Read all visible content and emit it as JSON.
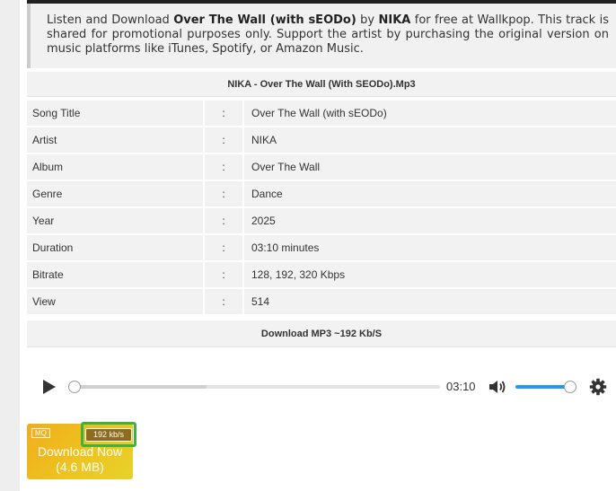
{
  "intro": {
    "t1": "Listen and Download ",
    "track": "Over The Wall (with sEODo)",
    "t2": " by ",
    "artist": "NIKA",
    "t3": " for free at Wallkpop. This track is shared for promotional purposes only. Support the artist by purchasing the original version on music platforms like iTunes, Spotify, or Amazon Music."
  },
  "file_title": "NIKA - Over The Wall (With SEODo).Mp3",
  "meta": [
    {
      "key": "Song Title",
      "sep": ":",
      "value": "Over The Wall (with sEODo)"
    },
    {
      "key": "Artist",
      "sep": ":",
      "value": "NIKA"
    },
    {
      "key": "Album",
      "sep": ":",
      "value": "Over The Wall"
    },
    {
      "key": "Genre",
      "sep": ":",
      "value": "Dance"
    },
    {
      "key": "Year",
      "sep": ":",
      "value": "2025"
    },
    {
      "key": "Duration",
      "sep": ":",
      "value": "03:10 minutes"
    },
    {
      "key": "Bitrate",
      "sep": ":",
      "value": "128, 192, 320 Kbps"
    },
    {
      "key": "View",
      "sep": ":",
      "value": "514"
    }
  ],
  "download_title": "Download MP3 ~192 Kb/S",
  "player": {
    "time": "03:10",
    "progress": 0,
    "volume": 1.0,
    "icons": {
      "play": "play-icon",
      "volume": "volume-icon",
      "settings": "gear-icon"
    }
  },
  "download_button": {
    "badge": "MQ",
    "bitrate": "192 kb/s",
    "line1": "Download Now",
    "line2": "(4.6 MB)"
  },
  "colors": {
    "accent": "#1d9bf0",
    "button": "#f0ad1e",
    "highlight": "#3cb43c"
  }
}
